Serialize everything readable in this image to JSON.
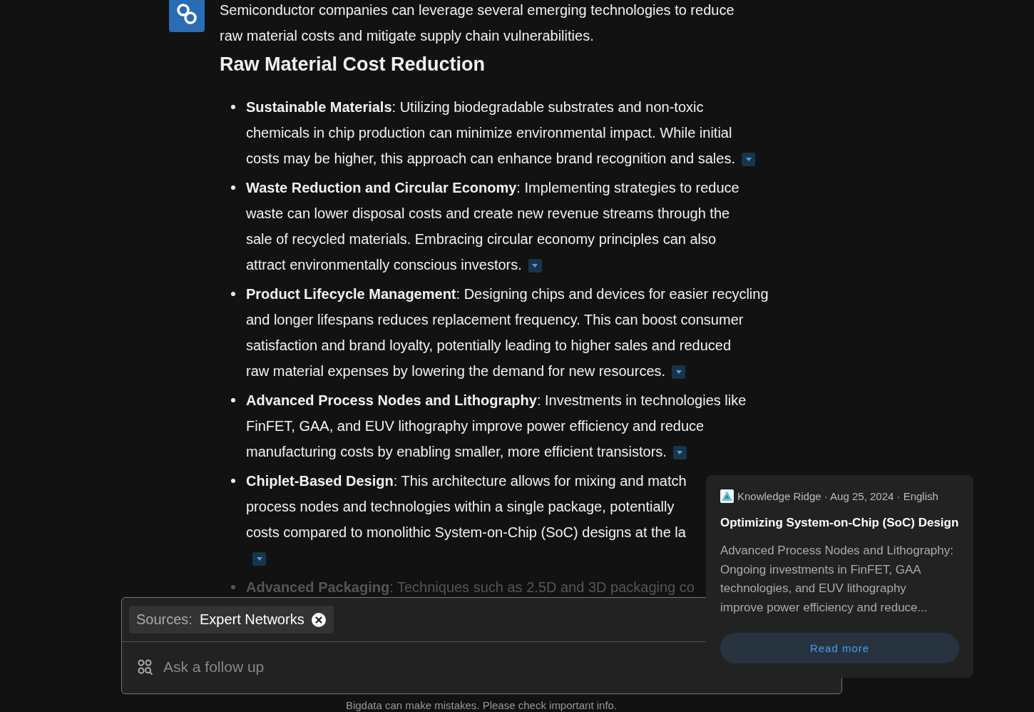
{
  "answer": {
    "intro_lines": [
      "Semiconductor companies can leverage several emerging technologies to reduce",
      "raw material costs and mitigate supply chain vulnerabilities."
    ],
    "heading": "Raw Material Cost Reduction",
    "items": [
      {
        "lines": [
          "**Sustainable Materials**: Utilizing biodegradable substrates and non-toxic",
          "chemicals in chip production can minimize environmental impact. While initial",
          "costs may be higher, this approach can enhance brand recognition and sales."
        ],
        "kind": "inline",
        "faded": false
      },
      {
        "lines": [
          "**Waste Reduction and Circular Economy**: Implementing strategies to reduce",
          "waste can lower disposal costs and create new revenue streams through the",
          "sale of recycled materials. Embracing circular economy principles can also",
          "attract environmentally conscious investors."
        ],
        "kind": "inline",
        "faded": false
      },
      {
        "lines": [
          "**Product Lifecycle Management**: Designing chips and devices for easier recycling",
          "and longer lifespans reduces replacement frequency. This can boost consumer",
          "satisfaction and brand loyalty, potentially leading to higher sales and reduced",
          "raw material expenses by lowering the demand for new resources."
        ],
        "kind": "inline",
        "faded": false
      },
      {
        "lines": [
          "**Advanced Process Nodes and Lithography**: Investments in technologies like",
          "FinFET, GAA, and EUV lithography improve power efficiency and reduce",
          "manufacturing costs by enabling smaller, more efficient transistors."
        ],
        "kind": "inline",
        "faded": false
      },
      {
        "lines": [
          "**Chiplet-Based Design**: This architecture allows for mixing and match",
          "process nodes and technologies within a single package, potentially",
          "costs compared to monolithic System-on-Chip (SoC) designs at the la"
        ],
        "kind": "below",
        "faded": false
      },
      {
        "lines": [
          "**Advanced Packaging**: Techniques such as 2.5D and 3D packaging co"
        ],
        "kind": "none",
        "faded": true
      }
    ]
  },
  "composer": {
    "source_label": "Sources:",
    "source_value": "Expert Networks",
    "placeholder": "Ask a follow up"
  },
  "popover": {
    "meta": "Knowledge Ridge · Aug 25, 2024 · English",
    "title": "Optimizing System-on-Chip (SoC) Design",
    "excerpt_lines": [
      "Advanced Process Nodes and Lithography:",
      "Ongoing investments in FinFET, GAA",
      "technologies, and EUV lithography",
      "improve power efficiency and reduce..."
    ],
    "button": "Read more"
  },
  "disclaimer": "Bigdata can make mistakes. Please check important info."
}
